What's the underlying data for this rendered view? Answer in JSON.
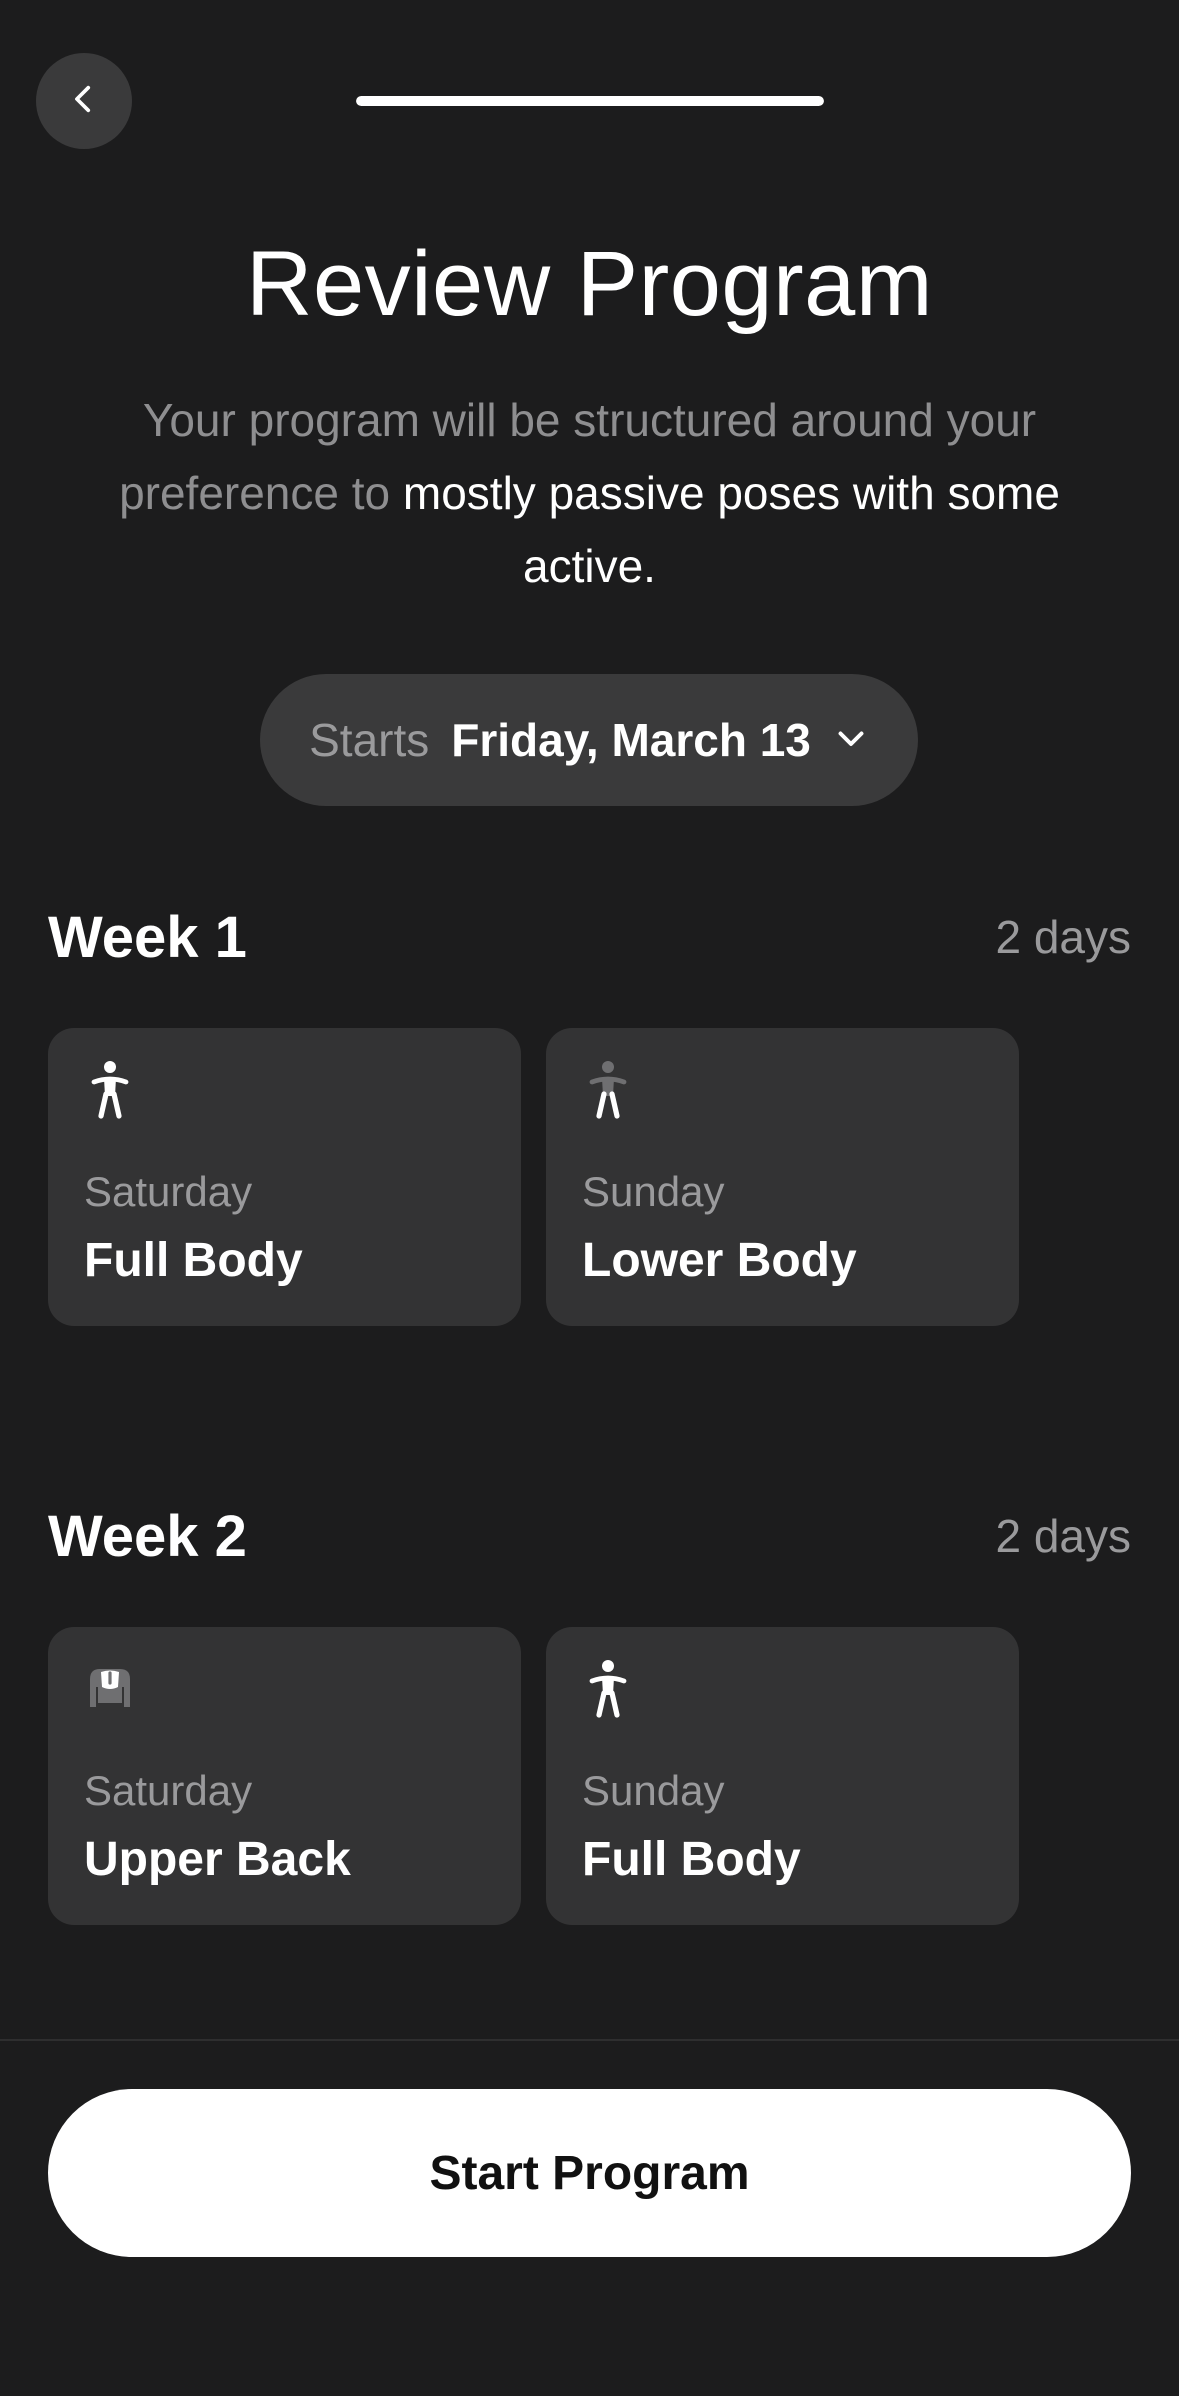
{
  "header": {
    "back_icon": "chevron-left-icon",
    "progress": 1.0
  },
  "title": "Review Program",
  "subtitle": {
    "prefix": "Your program will be structured around your preference to ",
    "highlight": "mostly passive poses with some active."
  },
  "start_date": {
    "label": "Starts",
    "value": "Friday, March 13",
    "icon": "chevron-down-icon"
  },
  "weeks": [
    {
      "title": "Week 1",
      "count": "2 days",
      "sessions": [
        {
          "day": "Saturday",
          "focus": "Full Body",
          "icon": "full-body-icon"
        },
        {
          "day": "Sunday",
          "focus": "Lower Body",
          "icon": "lower-body-icon"
        }
      ]
    },
    {
      "title": "Week 2",
      "count": "2 days",
      "sessions": [
        {
          "day": "Saturday",
          "focus": "Upper Back",
          "icon": "upper-back-icon"
        },
        {
          "day": "Sunday",
          "focus": "Full Body",
          "icon": "full-body-icon"
        }
      ]
    }
  ],
  "cta": {
    "label": "Start Program"
  },
  "colors": {
    "background": "#1c1c1d",
    "card": "#333334",
    "muted_text": "#9a9a9c",
    "primary_button": "#ffffff"
  }
}
